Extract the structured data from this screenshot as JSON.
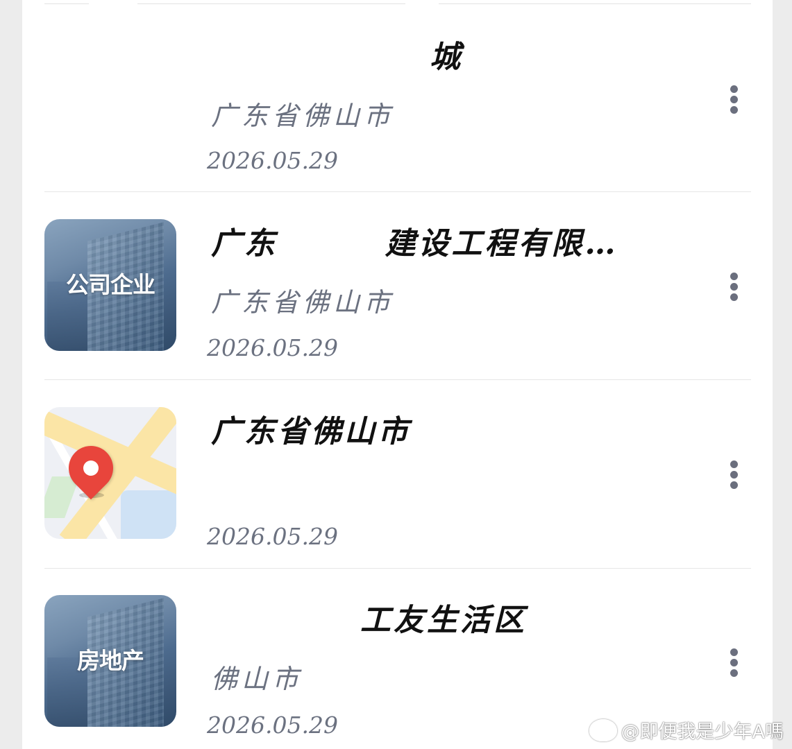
{
  "items": [
    {
      "title": "城",
      "location": "广东省佛山市",
      "date": "2026.05.29",
      "thumbnail_label": "",
      "thumbnail_type": "none",
      "more_icon": "more-vertical-icon"
    },
    {
      "title": "广东        建设工程有限…",
      "location": "广东省佛山市",
      "date": "2026.05.29",
      "thumbnail_label": "公司企业",
      "thumbnail_type": "building",
      "more_icon": "more-vertical-icon"
    },
    {
      "title": "广东省佛山市",
      "location": "",
      "date": "2026.05.29",
      "thumbnail_label": "",
      "thumbnail_type": "map-pin",
      "more_icon": "more-vertical-icon"
    },
    {
      "title": "工友生活区",
      "location": "佛山市",
      "date": "2026.05.29",
      "thumbnail_label": "房地产",
      "thumbnail_type": "building",
      "more_icon": "more-vertical-icon"
    }
  ],
  "watermark": {
    "icon": "weibo-icon",
    "text": "@即便我是少年A嗎"
  },
  "colors": {
    "background": "#ececec",
    "card": "#ffffff",
    "title": "#111111",
    "secondary_text": "#6b7180",
    "divider": "#e6e6e6",
    "pin": "#e8453c"
  }
}
